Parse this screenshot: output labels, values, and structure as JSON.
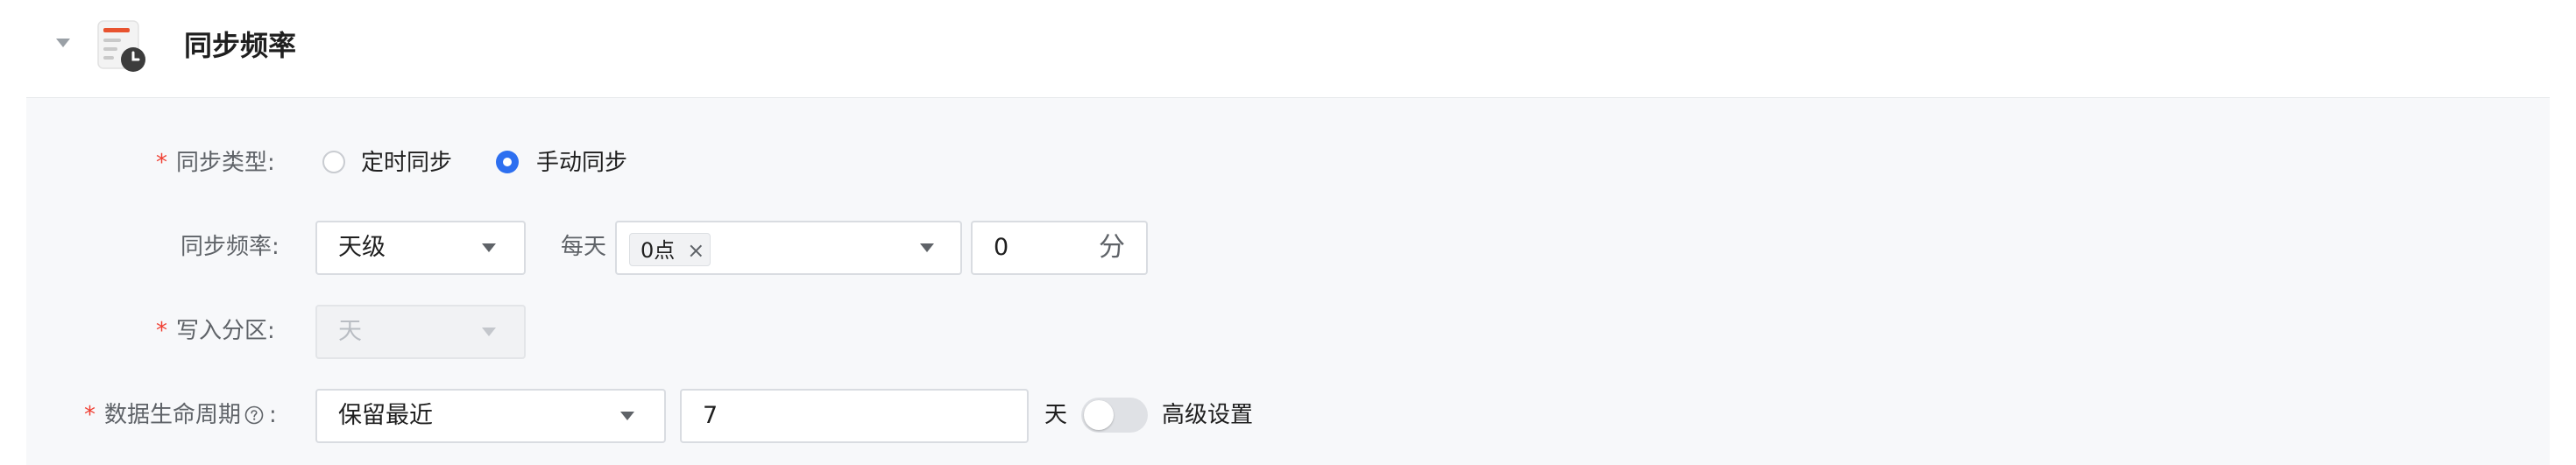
{
  "section": {
    "title": "同步频率",
    "icon": "schedule-document-icon"
  },
  "sync_type": {
    "label": "同步类型:",
    "required": true,
    "options": [
      {
        "label": "定时同步",
        "selected": false
      },
      {
        "label": "手动同步",
        "selected": true
      }
    ]
  },
  "sync_frequency": {
    "label": "同步频率:",
    "unit_select": "天级",
    "every_label": "每天",
    "hour_tag": "0点",
    "tag_close": "×",
    "minute_value": "0",
    "minute_suffix": "分"
  },
  "write_partition": {
    "label": "写入分区:",
    "required": true,
    "value": "天",
    "disabled": true
  },
  "data_lifecycle": {
    "label": "数据生命周期",
    "suffix": ":",
    "required": true,
    "mode": "保留最近",
    "days_value": "7",
    "days_unit": "天",
    "advanced_label": "高级设置",
    "advanced_enabled": false
  },
  "colors": {
    "accent": "#2d6ff0",
    "required": "#f04134",
    "panel_bg": "#f7f8fa"
  }
}
